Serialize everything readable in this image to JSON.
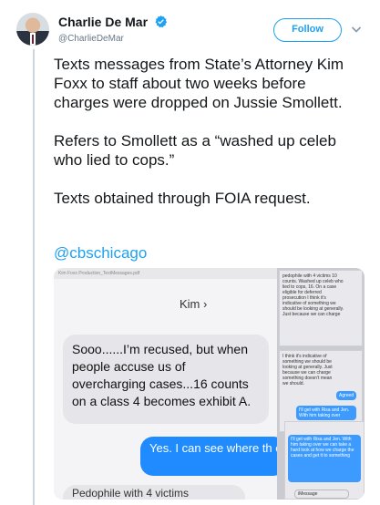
{
  "author": {
    "display_name": "Charlie De Mar",
    "handle": "@CharlieDeMar",
    "verified": true
  },
  "actions": {
    "follow_label": "Follow"
  },
  "tweet": {
    "paragraphs": [
      "Texts messages from State’s Attorney Kim Foxx to staff about two weeks before charges were dropped on Jussie Smollett.",
      "Refers to Smollett as a “washed up celeb who lied to cops.”",
      "Texts obtained through FOIA request."
    ],
    "mention": "@cbschicago"
  },
  "media": {
    "file_label": "Kim Foxx Production_TextMessages.pdf",
    "contact": "Kim",
    "messages": {
      "received_1": "Sooo......I’m recused, but when people accuse us of overcharging cases...16 counts on a class 4 becomes exhibit A.",
      "sent_1": "Yes. I can see where th can be seen as excess",
      "received_2": "Pedophile with 4 victims"
    },
    "side": {
      "panel_1": "pedophile with 4 victims 10 counts. Washed up celeb who lied to cops, 16. On a case eligible for deferred prosecution I think it's indicative of something we should be looking at generally. Just because we can charge",
      "panel_2": "I think it's indicative of something we should be looking at generally. Just because we can charge something doesn't mean we should.",
      "agreed": "Agreed",
      "panel_2_blue": "I'll get with Risa and Jen. With him taking over",
      "panel_3": "I'll get with Risa and Jen. With him taking over we can take a hard look at how we charge the cases and get it to something",
      "imessage": "iMessage"
    }
  },
  "colors": {
    "accent": "#1da1f2",
    "text": "#14171a",
    "muted": "#657786",
    "imessage_blue": "#1f8bff",
    "imessage_gray": "#e5e5ea"
  },
  "icons": {
    "verified": "verified-badge-icon",
    "chevron": "chevron-down-icon",
    "avatar": "avatar"
  }
}
